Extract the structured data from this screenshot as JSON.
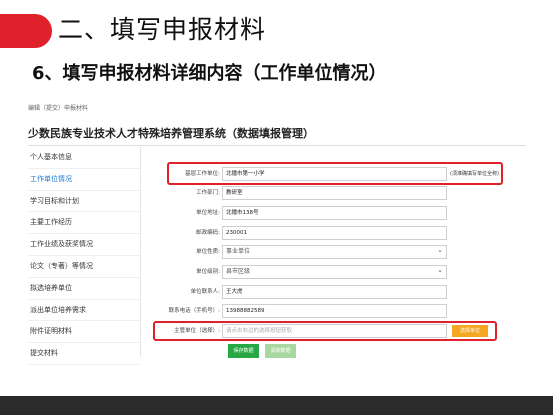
{
  "slide": {
    "title": "二、填写申报材料",
    "subtitle": "6、填写申报材料详细内容（工作单位情况）"
  },
  "app": {
    "breadcrumb": "编辑（提交）申报材料",
    "system_title": "少数民族专业技术人才特殊培养管理系统（数据填报管理）"
  },
  "sidebar": {
    "items": [
      {
        "label": "个人基本信息"
      },
      {
        "label": "工作单位情况"
      },
      {
        "label": "学习目标和计划"
      },
      {
        "label": "主要工作经历"
      },
      {
        "label": "工作业绩及获奖情况"
      },
      {
        "label": "论文（专著）等情况"
      },
      {
        "label": "拟选培养单位"
      },
      {
        "label": "派出单位培养需求"
      },
      {
        "label": "附件证明材料"
      },
      {
        "label": "提交材料"
      }
    ],
    "active_index": 1
  },
  "form": {
    "fields": [
      {
        "label": "基层工作单位:",
        "value": "北播市第一小学"
      },
      {
        "label": "工作部门:",
        "value": "教研室"
      },
      {
        "label": "单位地址:",
        "value": "北播市138号"
      },
      {
        "label": "邮政编码:",
        "value": "230001"
      },
      {
        "label": "单位性质:",
        "value": "事业单位"
      },
      {
        "label": "单位级别:",
        "value": "县市区级"
      },
      {
        "label": "单位联系人:",
        "value": "王大虎"
      },
      {
        "label": "联系电话（手机号）:",
        "value": "13988882589"
      },
      {
        "label": "主管单位（选择）:",
        "placeholder": "请点击右边的选择按钮获取"
      }
    ],
    "hint": "(须准确填写单位全称)",
    "choose_button": "选择单位",
    "save_button": "保存数据",
    "clear_button": "清除数据"
  },
  "colors": {
    "accent_red": "#e0202a",
    "save_green": "#28a745",
    "choose_orange": "#f5a623",
    "active_blue": "#1a7ad6"
  }
}
